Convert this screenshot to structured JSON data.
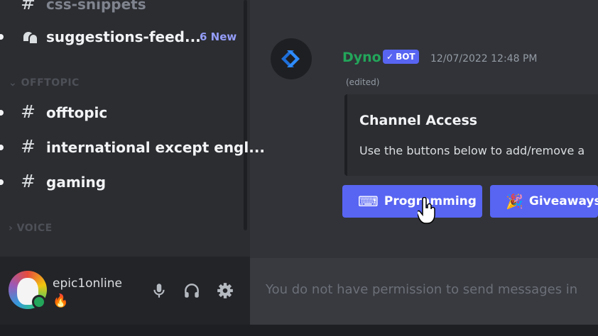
{
  "sidebar": {
    "channels": [
      {
        "name": "css-snippets",
        "icon": "hash-icon"
      },
      {
        "name": "suggestions-feed...",
        "icon": "forum-icon",
        "badge": "6 New"
      },
      {
        "name": "offtopic",
        "icon": "hash-icon"
      },
      {
        "name": "international except engl...",
        "icon": "hash-icon"
      },
      {
        "name": "gaming",
        "icon": "hash-icon"
      }
    ],
    "categories": {
      "offtopic": "OFFTOPIC",
      "voice": "VOICE"
    }
  },
  "user": {
    "name": "epic1online",
    "status_emoji": "🔥",
    "status": "online"
  },
  "message": {
    "author": "Dyno",
    "bot_badge": "BOT",
    "timestamp": "12/07/2022 12:48 PM",
    "edited": "(edited)",
    "embed": {
      "title": "Channel Access",
      "description": "Use the buttons below to add/remove a"
    },
    "buttons": [
      {
        "emoji": "⌨",
        "label": "Programming"
      },
      {
        "emoji": "🎉",
        "label": "Giveaways"
      }
    ]
  },
  "input": {
    "placeholder": "You do not have permission to send messages in"
  },
  "colors": {
    "accent": "#5865f2",
    "author": "#23a55a",
    "badge": "#949cf7"
  }
}
